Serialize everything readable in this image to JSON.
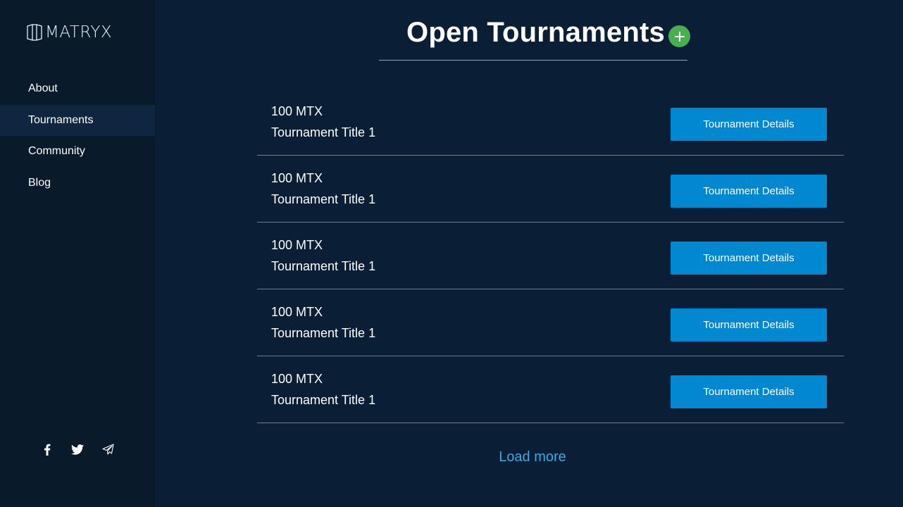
{
  "sidebar": {
    "logo_text": "MATRYX",
    "nav": [
      {
        "label": "About",
        "active": false
      },
      {
        "label": "Tournaments",
        "active": true
      },
      {
        "label": "Community",
        "active": false
      },
      {
        "label": "Blog",
        "active": false
      }
    ],
    "social": [
      "facebook-icon",
      "twitter-icon",
      "telegram-icon"
    ]
  },
  "main": {
    "title": "Open Tournaments",
    "add_icon": "plus-icon",
    "tournaments": [
      {
        "amount": "100 MTX",
        "title": "Tournament Title 1",
        "button": "Tournament Details"
      },
      {
        "amount": "100 MTX",
        "title": "Tournament Title 1",
        "button": "Tournament Details"
      },
      {
        "amount": "100 MTX",
        "title": "Tournament Title 1",
        "button": "Tournament Details"
      },
      {
        "amount": "100 MTX",
        "title": "Tournament Title 1",
        "button": "Tournament Details"
      },
      {
        "amount": "100 MTX",
        "title": "Tournament Title 1",
        "button": "Tournament Details"
      }
    ],
    "load_more": "Load more"
  },
  "colors": {
    "background": "#0a1f35",
    "sidebar": "#091a2b",
    "active_nav": "#0e2640",
    "button": "#0288d1",
    "add": "#45b04d",
    "link": "#3ea8e0"
  }
}
